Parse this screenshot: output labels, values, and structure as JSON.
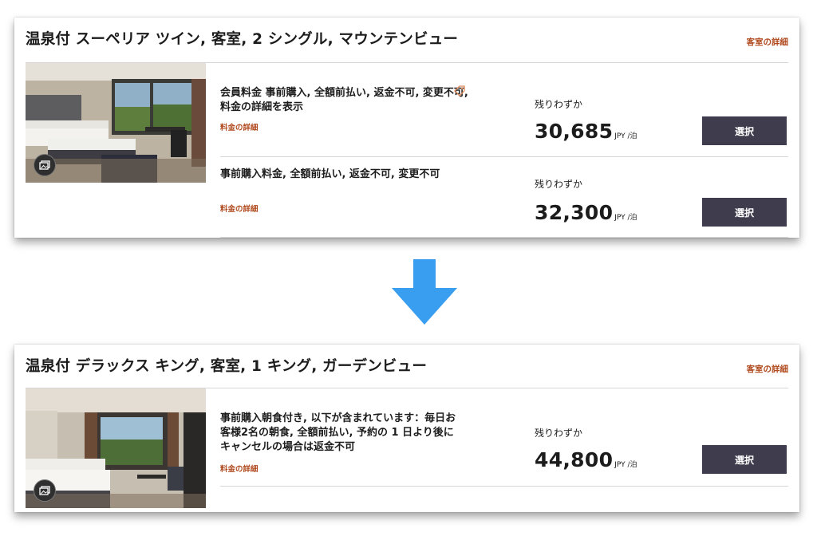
{
  "rooms": [
    {
      "title": "温泉付 スーペリア ツイン, 客室, 2 シングル, マウンテンビュー",
      "details_link": "客室の詳細",
      "rates": [
        {
          "description": "会員料金 事前購入, 全額前払い, 返金不可, 変更不可, 料金の詳細を表示",
          "details_link": "料金の詳細",
          "availability": "残りわずか",
          "price": "30,685",
          "unit": "JPY /泊",
          "select_label": "選択"
        },
        {
          "description": "事前購入料金, 全額前払い, 返金不可, 変更不可",
          "details_link": "料金の詳細",
          "availability": "残りわずか",
          "price": "32,300",
          "unit": "JPY /泊",
          "select_label": "選択"
        }
      ]
    },
    {
      "title": "温泉付 デラックス キング, 客室, 1 キング, ガーデンビュー",
      "details_link": "客室の詳細",
      "rates": [
        {
          "description": "事前購入朝食付き, 以下が含まれています：毎日お客様2名の朝食, 全額前払い, 予約の 1 日より後にキャンセルの場合は返金不可",
          "details_link": "料金の詳細",
          "availability": "残りわずか",
          "price": "44,800",
          "unit": "JPY /泊",
          "select_label": "選択"
        }
      ]
    }
  ],
  "icons": {
    "gallery": "gallery-icon",
    "member_tag": "tag-icon",
    "arrow": "arrow-down-icon"
  },
  "colors": {
    "accent": "#b04a1e",
    "button": "#3f3c4d",
    "arrow": "#3a9ef0"
  }
}
